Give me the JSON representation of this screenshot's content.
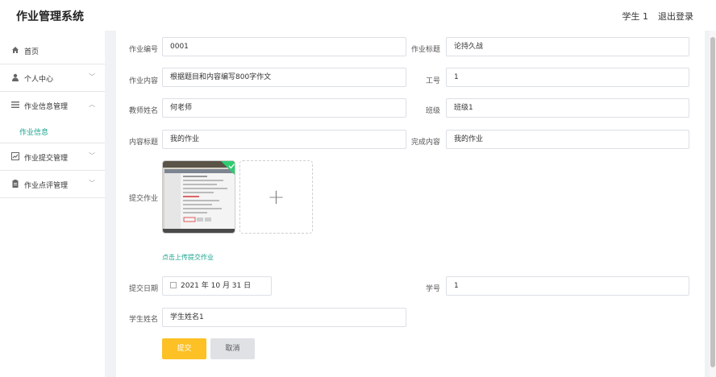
{
  "header": {
    "title": "作业管理系统",
    "user": "学生 1",
    "logout": "退出登录"
  },
  "sidebar": {
    "items": [
      {
        "label": "首页"
      },
      {
        "label": "个人中心"
      },
      {
        "label": "作业信息管理"
      },
      {
        "label": "作业信息"
      },
      {
        "label": "作业提交管理"
      },
      {
        "label": "作业点评管理"
      }
    ]
  },
  "form": {
    "homework_no": {
      "label": "作业编号",
      "value": "0001"
    },
    "homework_title": {
      "label": "作业标题",
      "value": "论持久战"
    },
    "homework_content": {
      "label": "作业内容",
      "value": "根据题目和内容编写800字作文"
    },
    "staff_no": {
      "label": "工号",
      "value": "1"
    },
    "teacher_name": {
      "label": "教师姓名",
      "value": "何老师"
    },
    "class": {
      "label": "班级",
      "value": "班级1"
    },
    "content_title": {
      "label": "内容标题",
      "value": "我的作业"
    },
    "completed_content": {
      "label": "完成内容",
      "value": "我的作业"
    },
    "submit_homework": {
      "label": "提交作业",
      "upload_tip": "点击上传提交作业",
      "plus": "+"
    },
    "submit_date": {
      "label": "提交日期",
      "value": "2021 年 10 月 31 日"
    },
    "student_no": {
      "label": "学号",
      "value": "1"
    },
    "student_name": {
      "label": "学生姓名",
      "value": "学生姓名1"
    },
    "submit_button": "提交",
    "cancel_button": "取消"
  },
  "colors": {
    "accent": "#19a38e",
    "submit": "#fdc126",
    "upload_ok": "#2ecc71"
  }
}
